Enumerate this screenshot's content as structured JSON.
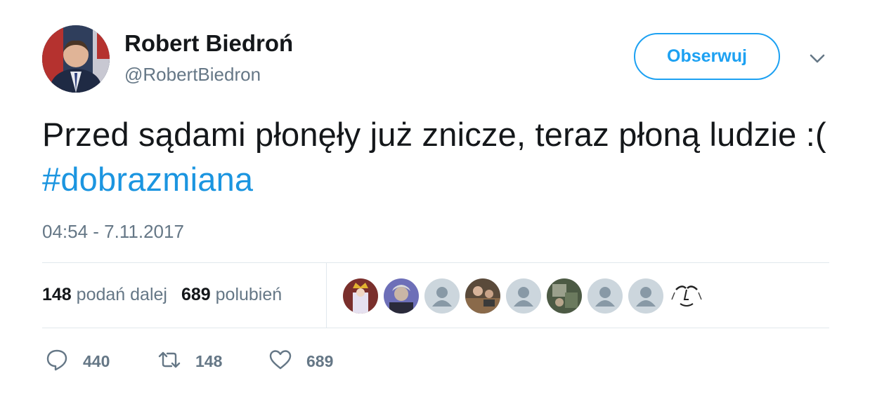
{
  "author": {
    "name": "Robert Biedroń",
    "handle": "@RobertBiedron"
  },
  "follow_button": {
    "label": "Obserwuj"
  },
  "tweet": {
    "text": "Przed sądami płonęły już znicze, teraz płoną ludzie :( ",
    "hashtag": "#dobrazmiana",
    "timestamp": "04:54 - 7.11.2017"
  },
  "stats": {
    "retweets_count": "148",
    "retweets_label": "podań dalej",
    "likes_count": "689",
    "likes_label": "polubień"
  },
  "actions": {
    "reply_count": "440",
    "retweet_count": "148",
    "like_count": "689"
  },
  "colors": {
    "accent": "#1da1f2",
    "text": "#14171a",
    "muted": "#657786",
    "divider": "#e1e8ed"
  }
}
